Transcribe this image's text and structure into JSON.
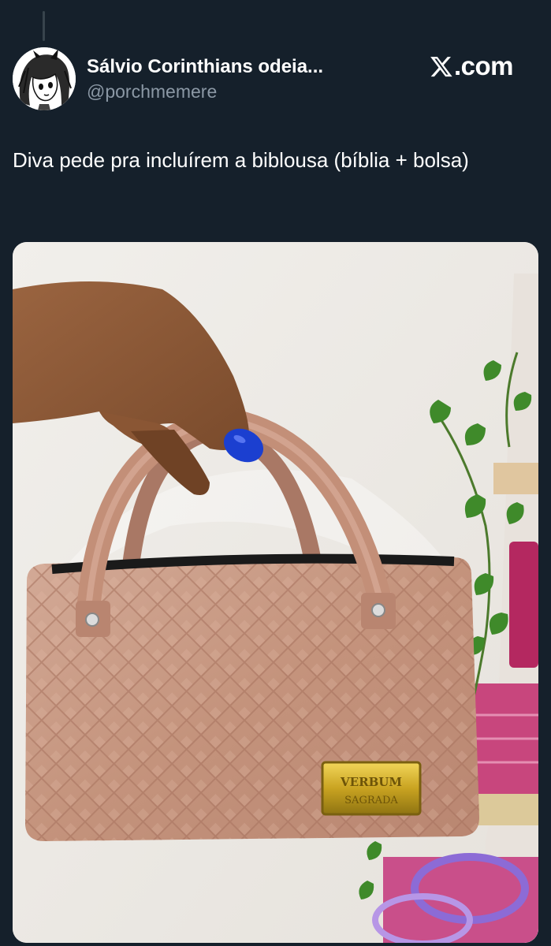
{
  "tweet": {
    "author": {
      "display_name": "Sálvio Corinthians odeia...",
      "handle": "@porchmemere",
      "avatar_icon": "anime-character-avatar"
    },
    "brand_label": ".com",
    "brand_icon": "x-logo-icon",
    "text": "Diva pede pra incluírem a biblousa (bíblia + bolsa)",
    "media": {
      "description_icon": "handbag-photo",
      "plate_text_line1": "VERBUM",
      "plate_text_line2": "SAGRADA"
    }
  },
  "colors": {
    "background": "#15202b",
    "primary_text": "#ffffff",
    "secondary_text": "#8b98a5",
    "bag": "#c99a86",
    "nail_polish": "#1b3fd0"
  }
}
